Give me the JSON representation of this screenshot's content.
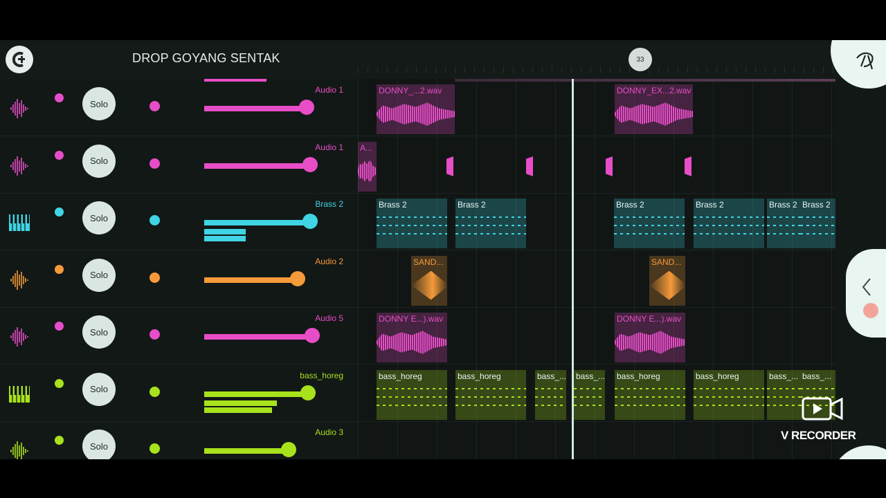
{
  "project": {
    "title": "DROP GOYANG SENTAK",
    "bar_marker": "33"
  },
  "colors": {
    "pink": "#e84dc8",
    "cyan": "#3fd5e4",
    "orange": "#f59a3a",
    "lime": "#a8e21c",
    "bg": "#121816"
  },
  "tracks": [
    {
      "name": "Audio 1",
      "type": "audio",
      "color": "#e84dc8",
      "solo_label": "Solo",
      "volume": 0.88
    },
    {
      "name": "Audio 1",
      "type": "audio",
      "color": "#e84dc8",
      "solo_label": "Solo",
      "volume": 0.91
    },
    {
      "name": "Brass 2",
      "type": "instrument",
      "color": "#3fd5e4",
      "solo_label": "Solo",
      "volume": 0.91
    },
    {
      "name": "Audio 2",
      "type": "audio",
      "color": "#f59a3a",
      "solo_label": "Solo",
      "volume": 0.8
    },
    {
      "name": "Audio 5",
      "type": "audio",
      "color": "#e84dc8",
      "solo_label": "Solo",
      "volume": 0.93
    },
    {
      "name": "bass_horeg",
      "type": "instrument",
      "color": "#a8e21c",
      "solo_label": "Solo",
      "volume": 0.89
    },
    {
      "name": "Audio 3",
      "type": "audio",
      "color": "#a8e21c",
      "solo_label": "Solo",
      "volume": 0.72
    }
  ],
  "clips": [
    {
      "lane": 0,
      "label": "DONNY_...2.wav"
    },
    {
      "lane": 0,
      "label": "DONNY_EX...2.wav"
    },
    {
      "lane": 1,
      "label": "A..."
    },
    {
      "lane": 2,
      "label": "Brass 2"
    },
    {
      "lane": 2,
      "label": "Brass 2"
    },
    {
      "lane": 2,
      "label": "Brass 2"
    },
    {
      "lane": 2,
      "label": "Brass 2"
    },
    {
      "lane": 2,
      "label": "Brass 2"
    },
    {
      "lane": 2,
      "label": "Brass 2"
    },
    {
      "lane": 3,
      "label": "SAND..."
    },
    {
      "lane": 3,
      "label": "SAND..."
    },
    {
      "lane": 4,
      "label": "DONNY E...).wav"
    },
    {
      "lane": 4,
      "label": "DONNY E...).wav"
    },
    {
      "lane": 5,
      "label": "bass_horeg"
    },
    {
      "lane": 5,
      "label": "bass_horeg"
    },
    {
      "lane": 5,
      "label": "bass_..."
    },
    {
      "lane": 5,
      "label": "bass_..."
    },
    {
      "lane": 5,
      "label": "bass_horeg"
    },
    {
      "lane": 5,
      "label": "bass_horeg"
    },
    {
      "lane": 5,
      "label": "bass_..."
    },
    {
      "lane": 5,
      "label": "bass_..."
    }
  ],
  "overlay": {
    "recorder_label": "V RECORDER"
  },
  "icons": {
    "logo": "app-logo-icon",
    "audio": "waveform-icon",
    "instrument": "piano-keys-icon",
    "speaker": "speaker-icon",
    "nav": "chevron-left-icon",
    "corner": "bird-icon"
  }
}
